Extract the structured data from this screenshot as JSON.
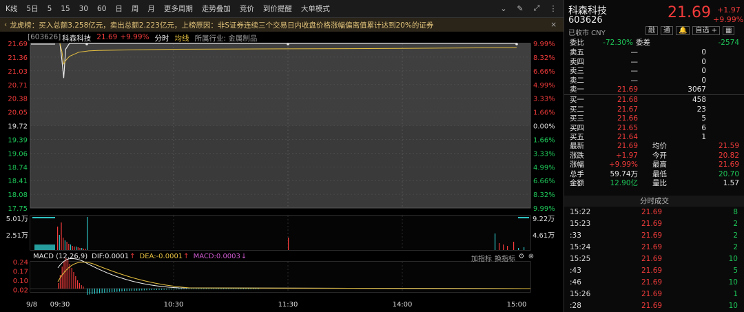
{
  "toolbar": {
    "items": [
      "K线",
      "5日",
      "5",
      "15",
      "30",
      "60",
      "日",
      "周",
      "月",
      "更多周期",
      "走势叠加",
      "竞价",
      "到价提醒",
      "大单模式"
    ]
  },
  "banner": {
    "title": "龙虎榜",
    "text": "买入总额3.258亿元，卖出总额2.223亿元，上榜原因：非S证券连续三个交易日内收盘价格涨幅偏离值累计达到20%的证券"
  },
  "chart_header": {
    "code": "[603626]",
    "name": "科森科技",
    "price": "21.69",
    "pct": "+9.99%",
    "mode": "分时",
    "avg_label": "均线",
    "industry": "所属行业: 金属制品"
  },
  "price_axis": {
    "left": [
      "21.69",
      "21.36",
      "21.03",
      "20.71",
      "20.38",
      "20.05",
      "19.72",
      "19.39",
      "19.06",
      "18.74",
      "18.41",
      "18.08",
      "17.75"
    ],
    "right": [
      "9.99%",
      "8.32%",
      "6.66%",
      "4.99%",
      "3.33%",
      "1.66%",
      "0.00%",
      "1.66%",
      "3.33%",
      "4.99%",
      "6.66%",
      "8.32%",
      "9.99%"
    ]
  },
  "volume_axis": {
    "left": [
      "5.01万",
      "2.51万"
    ],
    "right": [
      "9.22万",
      "4.61万"
    ]
  },
  "macd": {
    "label": "MACD (12,26,9)",
    "dif": "DIF:0.0001",
    "dea": "DEA:-0.0001",
    "macd": "MACD:0.0003",
    "axis": [
      "0.24",
      "0.17",
      "0.10",
      "0.02"
    ],
    "links": [
      "加指标",
      "换指标"
    ]
  },
  "time_axis": [
    "9/8",
    "09:30",
    "10:30",
    "11:30",
    "14:00",
    "15:00"
  ],
  "chart_data": [
    {
      "type": "line",
      "name": "intraday price",
      "x": [
        "09:30",
        "09:31",
        "09:32",
        "09:33",
        "09:35",
        "09:40",
        "09:45",
        "09:50",
        "10:00",
        "10:30",
        "11:30",
        "14:00",
        "15:00"
      ],
      "series": [
        {
          "values": [
            21.69,
            21.3,
            20.86,
            21.55,
            21.69,
            21.69,
            21.69,
            21.69,
            21.69,
            21.69,
            21.69,
            21.69,
            21.69
          ]
        },
        {
          "values": [
            21.69,
            21.5,
            21.2,
            21.28,
            21.38,
            21.48,
            21.51,
            21.52,
            21.53,
            21.55,
            21.56,
            21.57,
            21.59
          ]
        }
      ],
      "ylim": [
        17.75,
        21.69
      ]
    },
    {
      "type": "bar",
      "name": "volume",
      "ylim": [
        0,
        50100
      ]
    },
    {
      "type": "line",
      "name": "MACD",
      "ylim": [
        0,
        0.24
      ]
    }
  ],
  "right_panel": {
    "name": "科森科技",
    "code": "603626",
    "status": "已收市 CNY",
    "price": "21.69",
    "chg": "+1.97",
    "pct": "+9.99%",
    "tags": [
      "融",
      "通",
      "自选 +"
    ],
    "weibi": {
      "label": "委比",
      "value": "-72.30%",
      "label2": "委差",
      "value2": "-2574"
    },
    "asks": [
      {
        "label": "卖五",
        "price": "—",
        "vol": "0"
      },
      {
        "label": "卖四",
        "price": "—",
        "vol": "0"
      },
      {
        "label": "卖三",
        "price": "—",
        "vol": "0"
      },
      {
        "label": "卖二",
        "price": "—",
        "vol": "0"
      },
      {
        "label": "卖一",
        "price": "21.69",
        "vol": "3067"
      }
    ],
    "bids": [
      {
        "label": "买一",
        "price": "21.68",
        "vol": "458"
      },
      {
        "label": "买二",
        "price": "21.67",
        "vol": "23"
      },
      {
        "label": "买三",
        "price": "21.66",
        "vol": "5"
      },
      {
        "label": "买四",
        "price": "21.65",
        "vol": "6"
      },
      {
        "label": "买五",
        "price": "21.64",
        "vol": "1"
      }
    ],
    "stats": [
      {
        "l": "最新",
        "v": "21.69",
        "l2": "均价",
        "v2": "21.59"
      },
      {
        "l": "涨跌",
        "v": "+1.97",
        "l2": "今开",
        "v2": "20.82"
      },
      {
        "l": "涨幅",
        "v": "+9.99%",
        "l2": "最高",
        "v2": "21.69"
      },
      {
        "l": "总手",
        "v": "59.74万",
        "l2": "最低",
        "v2": "20.70"
      },
      {
        "l": "金额",
        "v": "12.90亿",
        "l2": "量比",
        "v2": "1.57"
      }
    ],
    "ticks_title": "分时成交",
    "ticks": [
      {
        "t": "15:22",
        "p": "21.69",
        "v": "8"
      },
      {
        "t": "15:23",
        "p": "21.69",
        "v": "2"
      },
      {
        "t": ":33",
        "p": "21.69",
        "v": "2"
      },
      {
        "t": "15:24",
        "p": "21.69",
        "v": "2"
      },
      {
        "t": "15:25",
        "p": "21.69",
        "v": "10"
      },
      {
        "t": ":43",
        "p": "21.69",
        "v": "5"
      },
      {
        "t": ":46",
        "p": "21.69",
        "v": "10"
      },
      {
        "t": "15:26",
        "p": "21.69",
        "v": "1"
      },
      {
        "t": ":28",
        "p": "21.69",
        "v": "10"
      }
    ]
  }
}
